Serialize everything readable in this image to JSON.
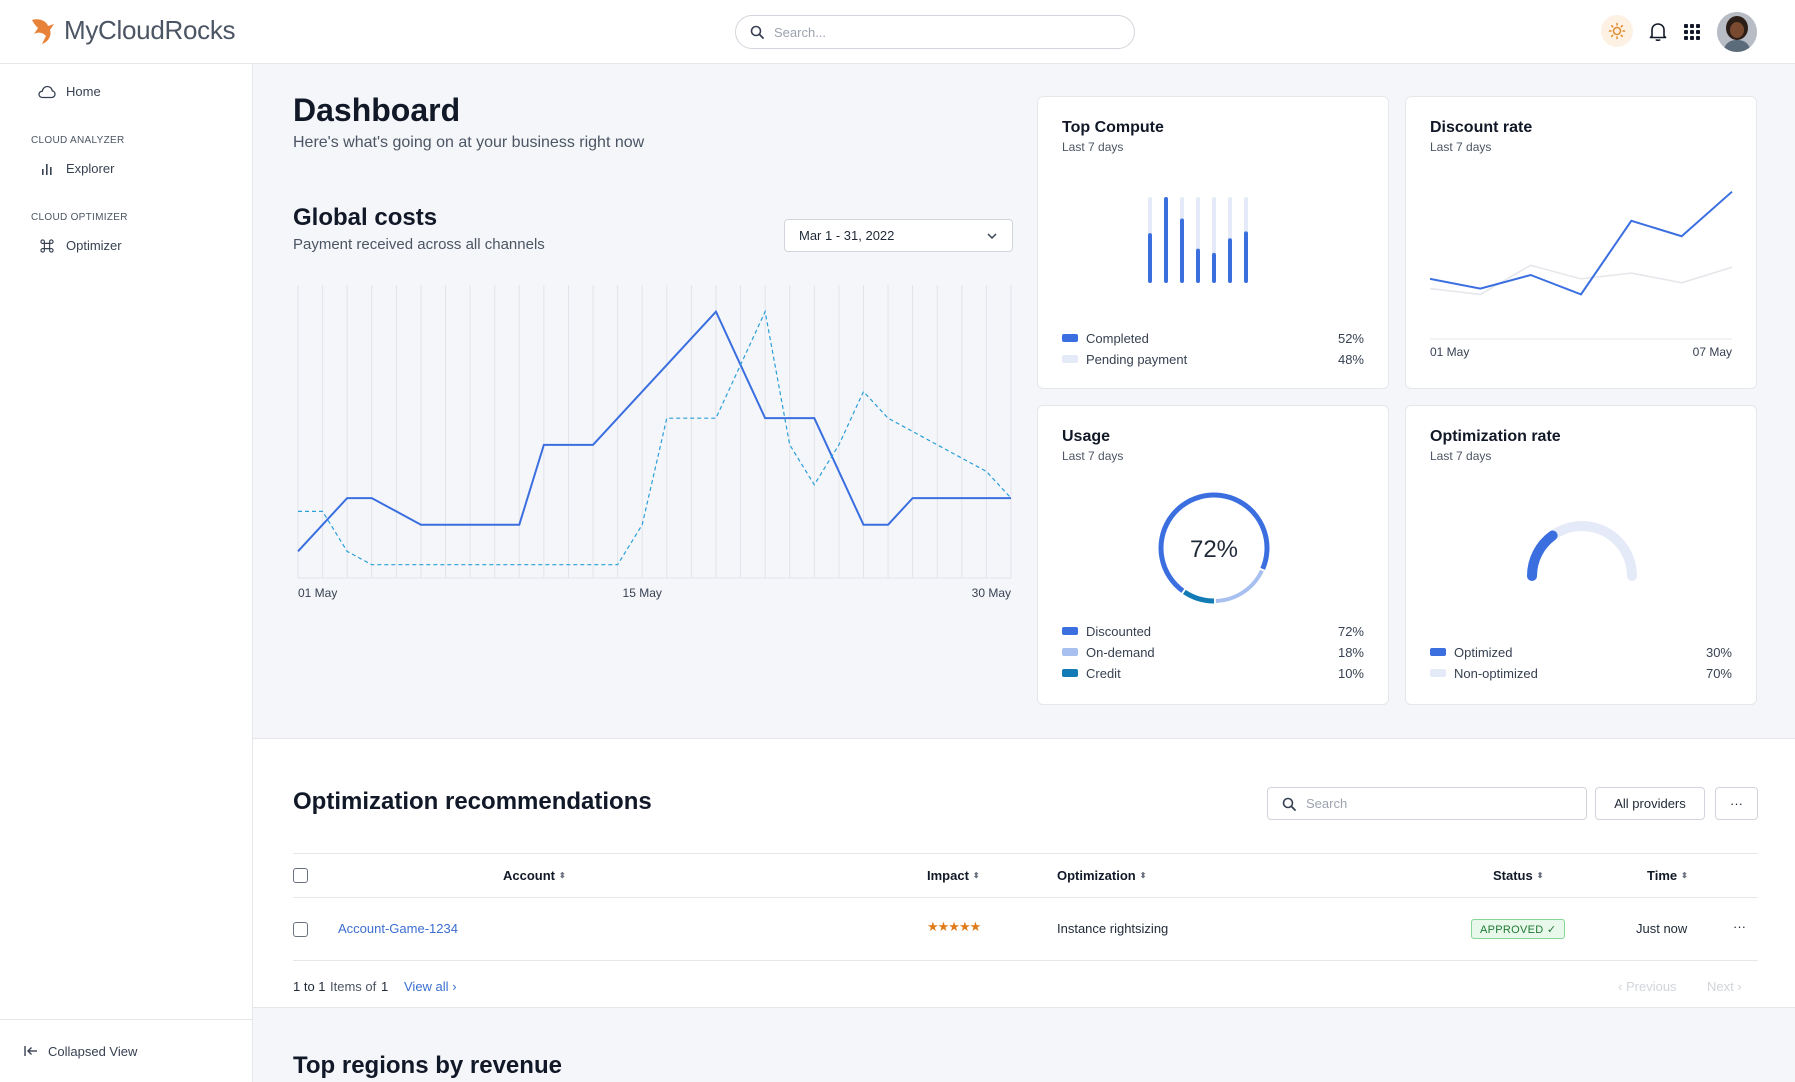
{
  "brand": {
    "name": "MyCloudRocks",
    "accent": "#e8823a"
  },
  "search": {
    "placeholder": "Search..."
  },
  "sidebar": {
    "home": "Home",
    "section_analyzer": "CLOUD ANALYZER",
    "explorer": "Explorer",
    "section_optimizer": "CLOUD OPTIMIZER",
    "optimizer": "Optimizer",
    "collapse": "Collapsed View"
  },
  "header": {
    "title": "Dashboard",
    "subtitle": "Here's what's going on at your business right now"
  },
  "global_costs": {
    "title": "Global costs",
    "subtitle": "Payment received across all channels",
    "date_range": "Mar 1 - 31, 2022"
  },
  "cards": {
    "top_compute": {
      "title": "Top Compute",
      "period": "Last 7 days",
      "legend": [
        {
          "label": "Completed",
          "value": "52%",
          "color": "#3b6fe0"
        },
        {
          "label": "Pending payment",
          "value": "48%",
          "color": "#e4eaf8"
        }
      ]
    },
    "discount_rate": {
      "title": "Discount rate",
      "period": "Last 7 days",
      "x_start": "01 May",
      "x_end": "07 May"
    },
    "usage": {
      "title": "Usage",
      "period": "Last 7 days",
      "center": "72%",
      "legend": [
        {
          "label": "Discounted",
          "value": "72%",
          "color": "#3b6fe0"
        },
        {
          "label": "On-demand",
          "value": "18%",
          "color": "#a8c0f0"
        },
        {
          "label": "Credit",
          "value": "10%",
          "color": "#127bb5"
        }
      ]
    },
    "optimization_rate": {
      "title": "Optimization rate",
      "period": "Last 7 days",
      "legend": [
        {
          "label": "Optimized",
          "value": "30%",
          "color": "#3b6fe0"
        },
        {
          "label": "Non-optimized",
          "value": "70%",
          "color": "#e4eaf8"
        }
      ]
    }
  },
  "recommendations": {
    "title": "Optimization recommendations",
    "search_placeholder": "Search",
    "providers": "All providers",
    "more": "···",
    "columns": {
      "account": "Account",
      "impact": "Impact",
      "optimization": "Optimization",
      "status": "Status",
      "time": "Time"
    },
    "rows": [
      {
        "account": "Account-Game-1234",
        "impact": "★★★★★",
        "optimization": "Instance rightsizing",
        "status": "APPROVED ✓",
        "time": "Just now",
        "more": "···"
      }
    ],
    "footer": {
      "range": "1 to 1",
      "items_label": "Items of",
      "total": "1",
      "view_all": "View all",
      "previous": "Previous",
      "next": "Next"
    }
  },
  "top_regions": {
    "title": "Top regions by revenue"
  },
  "chart_data": [
    {
      "type": "line",
      "x": [
        "01 May",
        "02 May",
        "03 May",
        "04 May",
        "05 May",
        "06 May",
        "07 May",
        "08 May",
        "09 May",
        "10 May",
        "11 May",
        "12 May",
        "13 May",
        "14 May",
        "15 May",
        "16 May",
        "17 May",
        "18 May",
        "19 May",
        "20 May",
        "21 May",
        "22 May",
        "23 May",
        "24 May",
        "25 May",
        "26 May",
        "27 May",
        "28 May",
        "29 May",
        "30 May"
      ],
      "x_tick_labels": [
        "01 May",
        "15 May",
        "30 May"
      ],
      "series": [
        {
          "style": "solid",
          "color": "#3b6fe0",
          "values": [
            10,
            20,
            30,
            30,
            25,
            20,
            20,
            20,
            20,
            20,
            50,
            50,
            50,
            60,
            70,
            80,
            90,
            100,
            80,
            60,
            60,
            60,
            40,
            20,
            20,
            30,
            30,
            30,
            30,
            30
          ]
        },
        {
          "style": "dashed",
          "color": "#2a9fd8",
          "values": [
            25,
            25,
            10,
            5,
            5,
            5,
            5,
            5,
            5,
            5,
            5,
            5,
            5,
            5,
            20,
            60,
            60,
            60,
            80,
            100,
            50,
            35,
            50,
            70,
            60,
            55,
            50,
            45,
            40,
            30
          ]
        }
      ],
      "ylim": [
        0,
        110
      ],
      "grid": "vertical"
    },
    {
      "type": "bar",
      "title": "Top Compute",
      "categories": [
        "1",
        "2",
        "3",
        "4",
        "5",
        "6",
        "7"
      ],
      "series": [
        {
          "name": "Completed",
          "color": "#3b6fe0",
          "values": [
            58,
            100,
            75,
            40,
            35,
            52,
            60
          ]
        },
        {
          "name": "Pending payment",
          "color": "#e4eaf8",
          "values": [
            100,
            100,
            100,
            100,
            100,
            100,
            100
          ]
        }
      ]
    },
    {
      "type": "line",
      "title": "Discount rate",
      "x": [
        "01 May",
        "02 May",
        "03 May",
        "04 May",
        "05 May",
        "06 May",
        "07 May"
      ],
      "series": [
        {
          "color": "#3b6fe0",
          "values": [
            30,
            25,
            32,
            22,
            60,
            52,
            75
          ]
        },
        {
          "color": "#e5e7eb",
          "values": [
            25,
            22,
            37,
            30,
            33,
            28,
            36
          ]
        }
      ],
      "ylim": [
        0,
        80
      ]
    },
    {
      "type": "pie",
      "title": "Usage",
      "labels": [
        "Discounted",
        "On-demand",
        "Credit"
      ],
      "values": [
        72,
        18,
        10
      ]
    },
    {
      "type": "pie",
      "title": "Optimization rate",
      "labels": [
        "Optimized",
        "Non-optimized"
      ],
      "values": [
        30,
        70
      ]
    }
  ]
}
